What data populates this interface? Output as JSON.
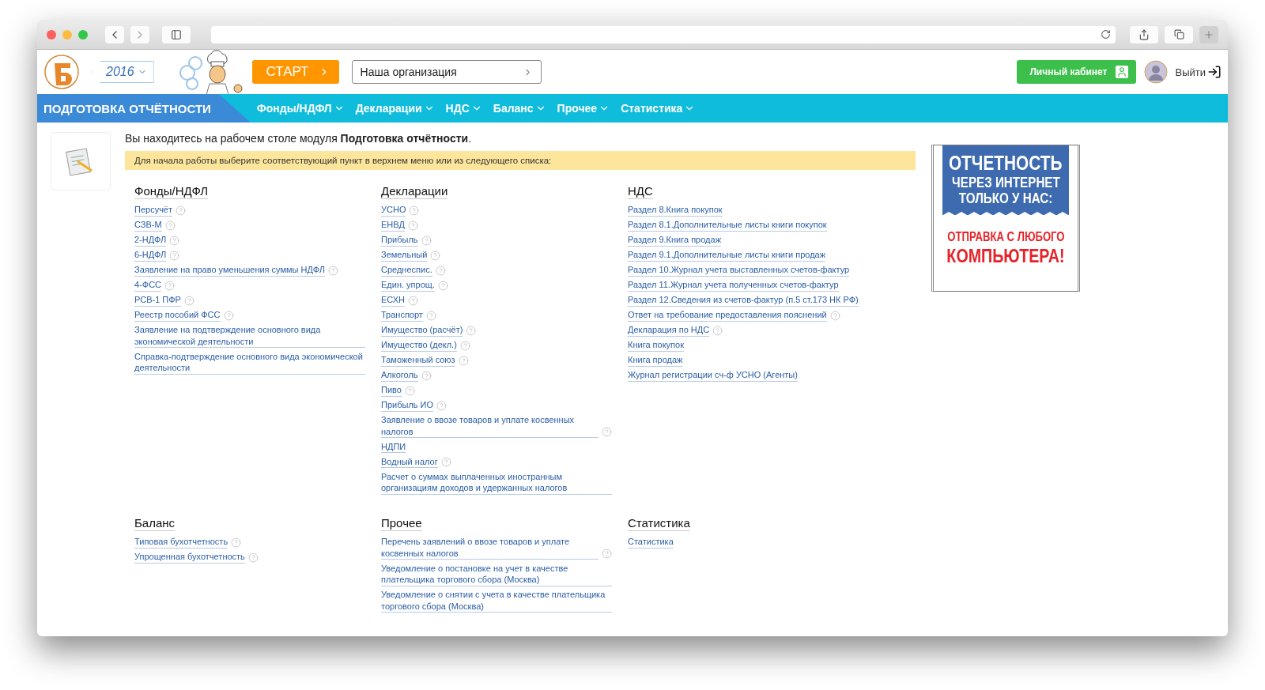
{
  "header": {
    "year": "2016",
    "start_button": "СТАРТ",
    "organization": "Наша организация",
    "cabinet_button": "Личный кабинет",
    "logout": "Выйти"
  },
  "nav": {
    "module_title": "ПОДГОТОВКА ОТЧЁТНОСТИ",
    "items": [
      "Фонды/НДФЛ",
      "Декларации",
      "НДС",
      "Баланс",
      "Прочее",
      "Статистика"
    ]
  },
  "intro": {
    "text": "Вы находитесь на рабочем столе модуля **Подготовка отчётности**.",
    "hint": "Для начала работы выберите соответствующий пункт в верхнем меню или из следующего списка:"
  },
  "sections": [
    {
      "title": "Фонды/НДФЛ",
      "links": [
        {
          "label": "Персучёт",
          "help": true
        },
        {
          "label": "СЗВ-М",
          "help": true
        },
        {
          "label": "2-НДФЛ",
          "help": true
        },
        {
          "label": "6-НДФЛ",
          "help": true
        },
        {
          "label": "Заявление на право уменьшения суммы НДФЛ",
          "help": true
        },
        {
          "label": "4-ФСС",
          "help": true
        },
        {
          "label": "РСВ-1 ПФР",
          "help": true
        },
        {
          "label": "Реестр пособий ФСС",
          "help": true
        },
        {
          "label": "Заявление на подтверждение основного вида экономической деятельности",
          "help": false
        },
        {
          "label": "Справка-подтверждение основного вида экономической деятельности",
          "help": false
        }
      ]
    },
    {
      "title": "Декларации",
      "links": [
        {
          "label": "УСНО",
          "help": true
        },
        {
          "label": "ЕНВД",
          "help": true
        },
        {
          "label": "Прибыль",
          "help": true
        },
        {
          "label": "Земельный",
          "help": true
        },
        {
          "label": "Среднеспис.",
          "help": true
        },
        {
          "label": "Един. упрощ.",
          "help": true
        },
        {
          "label": "ЕСХН",
          "help": true
        },
        {
          "label": "Транспорт",
          "help": true
        },
        {
          "label": "Имущество (расчёт)",
          "help": true
        },
        {
          "label": "Имущество (декл.)",
          "help": true
        },
        {
          "label": "Таможенный союз",
          "help": true
        },
        {
          "label": "Алкоголь",
          "help": true
        },
        {
          "label": "Пиво",
          "help": true
        },
        {
          "label": "Прибыль ИО",
          "help": true
        },
        {
          "label": "Заявление о ввозе товаров и уплате косвенных налогов",
          "help": true
        },
        {
          "label": "НДПИ",
          "help": false
        },
        {
          "label": "Водный налог",
          "help": true
        },
        {
          "label": "Расчет о суммах выплаченных иностранным организациям доходов и удержанных налогов",
          "help": false
        }
      ]
    },
    {
      "title": "НДС",
      "links": [
        {
          "label": "Раздел 8.Книга покупок",
          "help": false
        },
        {
          "label": "Раздел 8.1.Дополнительные листы книги покупок",
          "help": false
        },
        {
          "label": "Раздел 9.Книга продаж",
          "help": false
        },
        {
          "label": "Раздел 9.1.Дополнительные листы книги продаж",
          "help": false
        },
        {
          "label": "Раздел 10.Журнал учета выставленных счетов-фактур",
          "help": false
        },
        {
          "label": "Раздел 11.Журнал учета полученных счетов-фактур",
          "help": false
        },
        {
          "label": "Раздел 12.Сведения из счетов-фактур (п.5 ст.173 НК РФ)",
          "help": false
        },
        {
          "label": "Ответ на требование предоставления пояснений",
          "help": true
        },
        {
          "label": "Декларация по НДС",
          "help": true
        },
        {
          "label": "Книга покупок",
          "help": false
        },
        {
          "label": "Книга продаж",
          "help": false
        },
        {
          "label": "Журнал регистрации сч-ф УСНО (Агенты)",
          "help": false
        }
      ]
    },
    {
      "title": "Баланс",
      "links": [
        {
          "label": "Типовая бухотчетность",
          "help": true
        },
        {
          "label": "Упрощенная бухотчетность",
          "help": true
        }
      ]
    },
    {
      "title": "Прочее",
      "links": [
        {
          "label": "Перечень заявлений о ввозе товаров и уплате косвенных налогов",
          "help": true
        },
        {
          "label": "Уведомление о постановке на учет в качестве плательщика торгового сбора (Москва)",
          "help": false
        },
        {
          "label": "Уведомление о снятии с учета в качестве плательщика торгового сбора (Москва)",
          "help": false
        }
      ]
    },
    {
      "title": "Статистика",
      "links": [
        {
          "label": "Статистика",
          "help": false
        }
      ]
    }
  ],
  "ad": {
    "lines": [
      "ОТЧЕТНОСТЬ",
      "ЧЕРЕЗ ИНТЕРНЕТ",
      "ТОЛЬКО У НАС:"
    ],
    "tagline": [
      "ОТПРАВКА С ЛЮБОГО",
      "КОМПЬЮТЕРА!"
    ]
  }
}
